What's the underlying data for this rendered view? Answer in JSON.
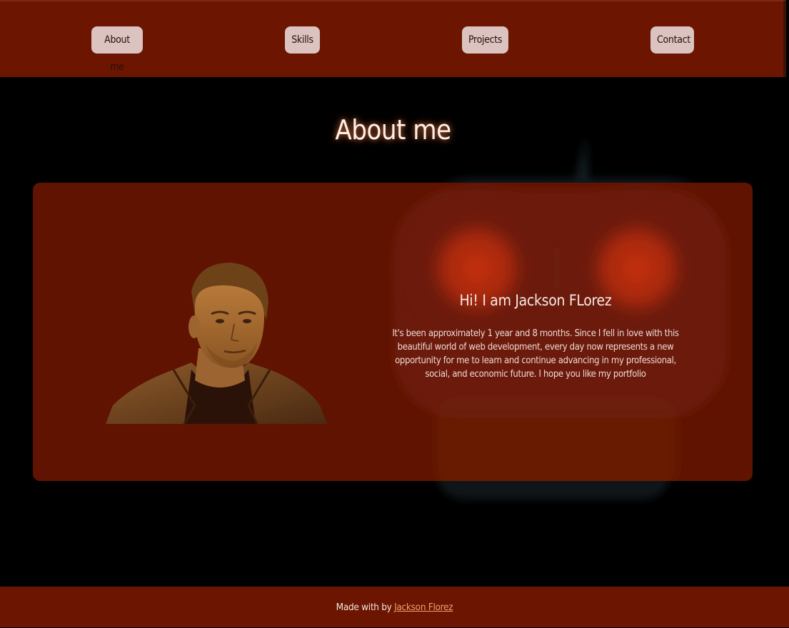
{
  "nav": {
    "items": [
      {
        "label": "About me"
      },
      {
        "label": "Skills"
      },
      {
        "label": "Projects"
      },
      {
        "label": "Contact"
      }
    ]
  },
  "section": {
    "title": "About me"
  },
  "about": {
    "greeting": "Hi! I am Jackson FLorez",
    "bio": "It's been approximately 1 year and 8 months. Since I fell in love with this beautiful world of web development, every day now represents a new opportunity for me to learn and continue advancing in my professional, social, and economic future. I hope you like my portfolio"
  },
  "footer": {
    "prefix": "Made with by",
    "author": "Jackson Florez"
  },
  "colors": {
    "nav_bg": "#6c1500",
    "button_bg": "#dbc3c0",
    "card_bg": "#671400",
    "link": "#f0a070"
  },
  "icons": [
    "portrait-photo",
    "mask-background-image"
  ]
}
